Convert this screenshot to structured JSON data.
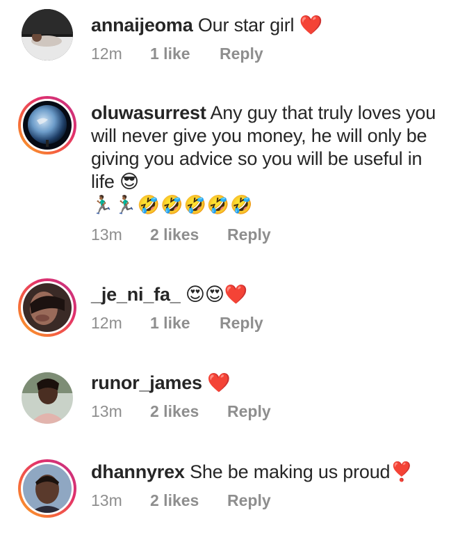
{
  "comments": [
    {
      "username": "annaijeoma",
      "text": "Our star girl ❤️",
      "time": "12m",
      "likes": "1 like",
      "reply": "Reply",
      "avatar_icon": "person-lying-photo"
    },
    {
      "username": "oluwasurrest",
      "text": "Any guy that truly loves you will never give you money, he will only be giving you advice so you will be useful in life 😎",
      "emoji_line": "🏃🏾‍♂️🏃🏾‍♂️🤣🤣🤣🤣🤣",
      "time": "13m",
      "likes": "2 likes",
      "reply": "Reply",
      "avatar_icon": "earth-photo"
    },
    {
      "username": "_je_ni_fa_",
      "text": "😍😍❤️",
      "time": "12m",
      "likes": "1 like",
      "reply": "Reply",
      "avatar_icon": "portrait-photo"
    },
    {
      "username": "runor_james",
      "text": "❤️",
      "time": "13m",
      "likes": "2 likes",
      "reply": "Reply",
      "avatar_icon": "portrait-photo"
    },
    {
      "username": "dhannyrex",
      "text": "She be making us proud❣️",
      "time": "13m",
      "likes": "2 likes",
      "reply": "Reply",
      "avatar_icon": "portrait-photo"
    }
  ],
  "colors": {
    "text": "#262626",
    "meta": "#8e8e8e",
    "story_ring_start": "#f9a825",
    "story_ring_end": "#c13584"
  }
}
